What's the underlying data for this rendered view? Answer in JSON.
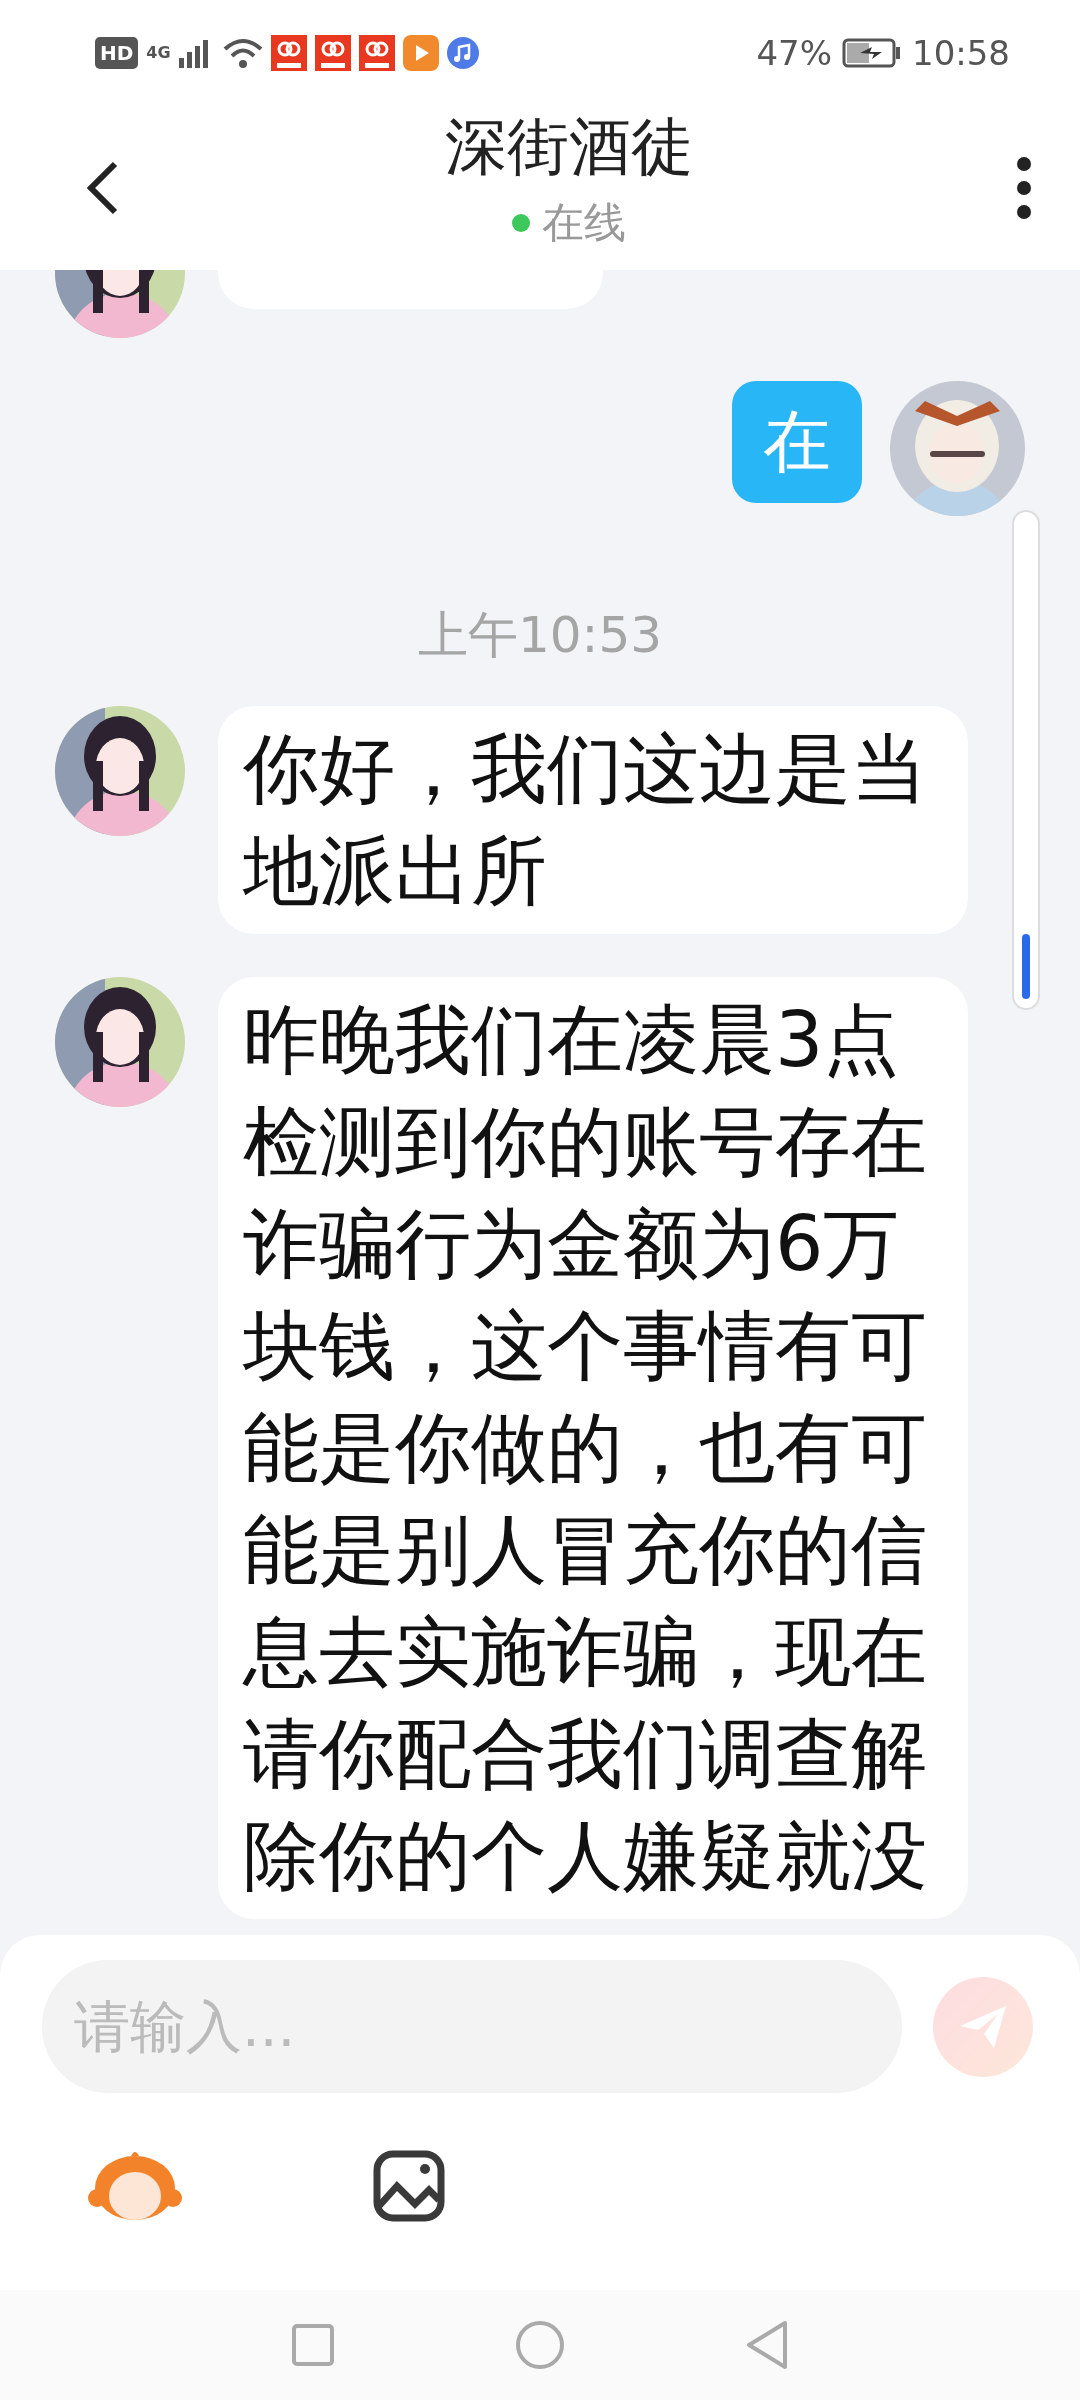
{
  "status_bar": {
    "network_badge": "HD",
    "network_type": "4G",
    "battery": "47%",
    "time": "10:58"
  },
  "header": {
    "title": "深街酒徒",
    "status": "在线",
    "online": true
  },
  "messages": [
    {
      "kind": "partial"
    },
    {
      "kind": "outgoing",
      "text": "在"
    },
    {
      "kind": "time",
      "text": "上午10:53"
    },
    {
      "kind": "incoming",
      "text": "你好，我们这边是当地派出所"
    },
    {
      "kind": "incoming",
      "text": "昨晚我们在凌晨3点检测到你的账号存在诈骗行为金额为6万块钱，这个事情有可能是你做的，也有可能是别人冒充你的信息去实施诈骗，现在请你配合我们调查解除你的个人嫌疑就没"
    }
  ],
  "composer": {
    "placeholder": "请输入...",
    "send_disabled": true
  }
}
